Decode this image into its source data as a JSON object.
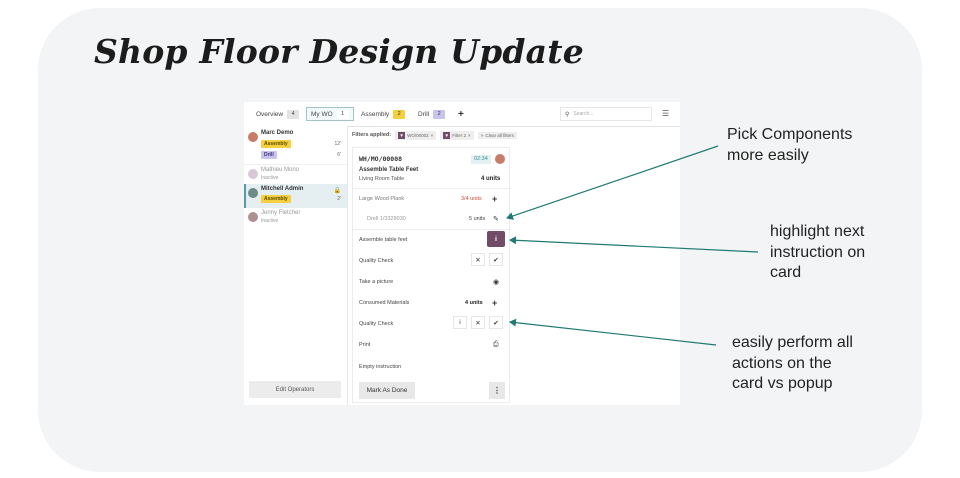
{
  "slide": {
    "title": "Shop Floor Design Update",
    "annotations": [
      {
        "lines": [
          "Pick Components",
          "more easily"
        ]
      },
      {
        "lines": [
          "highlight next",
          "instruction on",
          "card"
        ]
      },
      {
        "lines": [
          "easily perform all",
          "actions on the",
          "card vs popup"
        ]
      }
    ]
  },
  "colors": {
    "accent": "#714b67",
    "teal": "#3b8f93",
    "arrow": "#1f7a73"
  },
  "app": {
    "tabs": [
      {
        "label": "Overview",
        "count": "4",
        "count_bg": "#e3e3e3",
        "count_fg": "#444"
      },
      {
        "label": "My WO",
        "count": "1",
        "count_bg": "#ffffff",
        "count_fg": "#444"
      },
      {
        "label": "Assembly",
        "count": "2",
        "count_bg": "#f4d03f",
        "count_fg": "#333"
      },
      {
        "label": "Drill",
        "count": "2",
        "count_bg": "#c9c3ef",
        "count_fg": "#333"
      }
    ],
    "search_placeholder": "Search...",
    "operators": [
      {
        "name": "Marc Demo",
        "tags": [
          {
            "label": "Assembly",
            "time": "12'"
          },
          {
            "label": "Drill",
            "time": "6'"
          }
        ]
      },
      {
        "name": "Mathieu Mono",
        "sub": "Inactive"
      },
      {
        "name": "Mitchell Admin",
        "tag": "Assembly",
        "time": "2'"
      },
      {
        "name": "Jenny Fletcher",
        "sub": "Inactive"
      }
    ],
    "edit_operators": "Edit Operators",
    "filters_label": "Filters applied:",
    "filter_chips": [
      "WO/00002",
      "Filter 2"
    ],
    "clear_filters": "Clear all filters",
    "card": {
      "wo_number": "WH/MO/00008",
      "timer": "02:34",
      "product": "Assemble Table Feet",
      "workcenter": "Living Room Table",
      "qty": "4 units",
      "component": {
        "label": "Large Wood Plank",
        "value": "3/4 units"
      },
      "sub_component": {
        "label": "Drell 1/3328030",
        "value": "5 units"
      },
      "steps": [
        "Assemble table feet",
        "Quality Check",
        "Take a picture",
        "Consumed Materials",
        "Quality Check",
        "Print",
        "Empty instruction"
      ],
      "consumed_qty": "4 units",
      "mark_done": "Mark As Done"
    }
  }
}
